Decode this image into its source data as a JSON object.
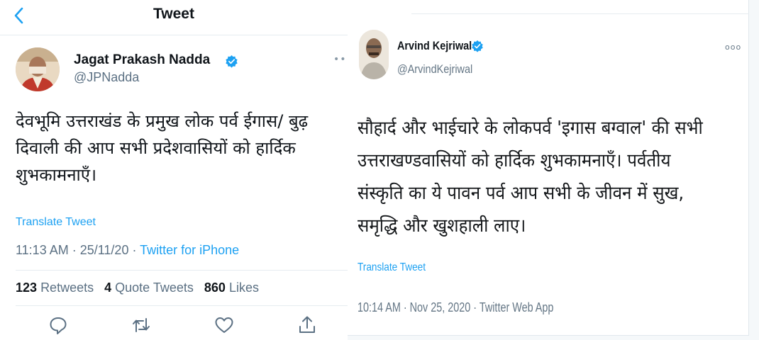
{
  "left_tweet": {
    "header": {
      "title": "Tweet"
    },
    "author": {
      "name": "Jagat Prakash Nadda",
      "handle": "@JPNadda"
    },
    "text": "देवभूमि उत्तराखंड के प्रमुख लोक पर्व ईगास/ बुढ़ दिवाली की आप सभी प्रदेशवासियों को हार्दिक शुभकामनाएँ।",
    "translate": "Translate Tweet",
    "time": "11:13 AM",
    "date": "25/11/20",
    "meta_sep": " · ",
    "source": "Twitter for iPhone",
    "stats": {
      "retweets_count": "123",
      "retweets_label": "Retweets",
      "quote_count": "4",
      "quote_label": "Quote Tweets",
      "likes_count": "860",
      "likes_label": "Likes"
    },
    "icons": [
      "back-arrow-icon",
      "verified-badge-icon",
      "reply-icon",
      "retweet-icon",
      "like-icon",
      "share-icon"
    ]
  },
  "right_tweet": {
    "author": {
      "name": "Arvind Kejriwal",
      "handle": "@ArvindKejriwal"
    },
    "text": "सौहार्द और भाईचारे के लोकपर्व 'इगास बग्वाल' की सभी उत्तराखण्डवासियों को हार्दिक शुभकामनाएँ। पर्वतीय संस्कृति का ये पावन पर्व आप सभी के जीवन में सुख, समृद्धि और खुशहाली लाए।",
    "translate": "Translate Tweet",
    "meta": "10:14 AM · Nov 25, 2020 · Twitter Web App"
  },
  "colors": {
    "accent": "#1da1f2",
    "secondary_text": "#5b7083",
    "divider": "#e6ecf0",
    "verified": "#1da1f2"
  }
}
